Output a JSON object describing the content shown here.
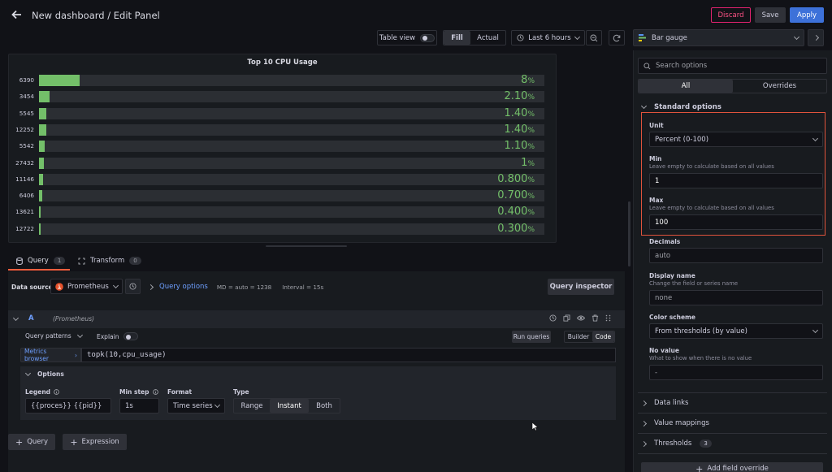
{
  "header": {
    "title": "New dashboard / Edit Panel",
    "discard": "Discard",
    "save": "Save",
    "apply": "Apply"
  },
  "toolbar": {
    "table_view": "Table view",
    "fill": "Fill",
    "actual": "Actual",
    "time_range": "Last 6 hours"
  },
  "visualization": {
    "name": "Bar gauge"
  },
  "chart_data": {
    "type": "bar",
    "orientation": "horizontal",
    "title": "Top 10 CPU Usage",
    "categories": [
      "6390",
      "3454",
      "5545",
      "12252",
      "5542",
      "27432",
      "11146",
      "6406",
      "13621",
      "12722"
    ],
    "values": [
      8,
      2.1,
      1.4,
      1.4,
      1.1,
      1,
      0.8,
      0.7,
      0.4,
      0.3
    ],
    "value_labels": [
      "8",
      "2.10",
      "1.40",
      "1.40",
      "1.10",
      "1",
      "0.800",
      "0.700",
      "0.400",
      "0.300"
    ],
    "unit": "%",
    "xlim": [
      0,
      100
    ],
    "color": "#73bf69"
  },
  "query_tabs": {
    "query": "Query",
    "query_count": "1",
    "transform": "Transform",
    "transform_count": "0"
  },
  "datasource": {
    "label": "Data source",
    "name": "Prometheus",
    "query_options": "Query options",
    "md": "MD = auto = 1238",
    "interval": "Interval = 15s",
    "inspector": "Query inspector"
  },
  "query": {
    "ref": "A",
    "source": "(Prometheus)",
    "patterns": "Query patterns",
    "explain": "Explain",
    "run": "Run queries",
    "builder": "Builder",
    "code": "Code",
    "metrics_browser": "Metrics browser",
    "expression": "topk(10,cpu_usage)",
    "options_title": "Options",
    "legend_label": "Legend",
    "legend_value": "{{proces}} {{pid}}",
    "minstep_label": "Min step",
    "minstep_value": "1s",
    "format_label": "Format",
    "format_value": "Time series",
    "type_label": "Type",
    "type_range": "Range",
    "type_instant": "Instant",
    "type_both": "Both"
  },
  "bottom_buttons": {
    "add_query": "Query",
    "add_expression": "Expression"
  },
  "options": {
    "search_placeholder": "Search options",
    "tab_all": "All",
    "tab_overrides": "Overrides",
    "standard": "Standard options",
    "unit_label": "Unit",
    "unit_value": "Percent (0-100)",
    "min_label": "Min",
    "min_desc": "Leave empty to calculate based on all values",
    "min_value": "1",
    "max_label": "Max",
    "max_desc": "Leave empty to calculate based on all values",
    "max_value": "100",
    "decimals_label": "Decimals",
    "decimals_placeholder": "auto",
    "display_name_label": "Display name",
    "display_name_desc": "Change the field or series name",
    "display_name_placeholder": "none",
    "color_scheme_label": "Color scheme",
    "color_scheme_value": "From thresholds (by value)",
    "no_value_label": "No value",
    "no_value_desc": "What to show when there is no value",
    "no_value_placeholder": "-",
    "data_links": "Data links",
    "value_mappings": "Value mappings",
    "thresholds": "Thresholds",
    "thresholds_count": "3",
    "add_override": "Add field override"
  }
}
